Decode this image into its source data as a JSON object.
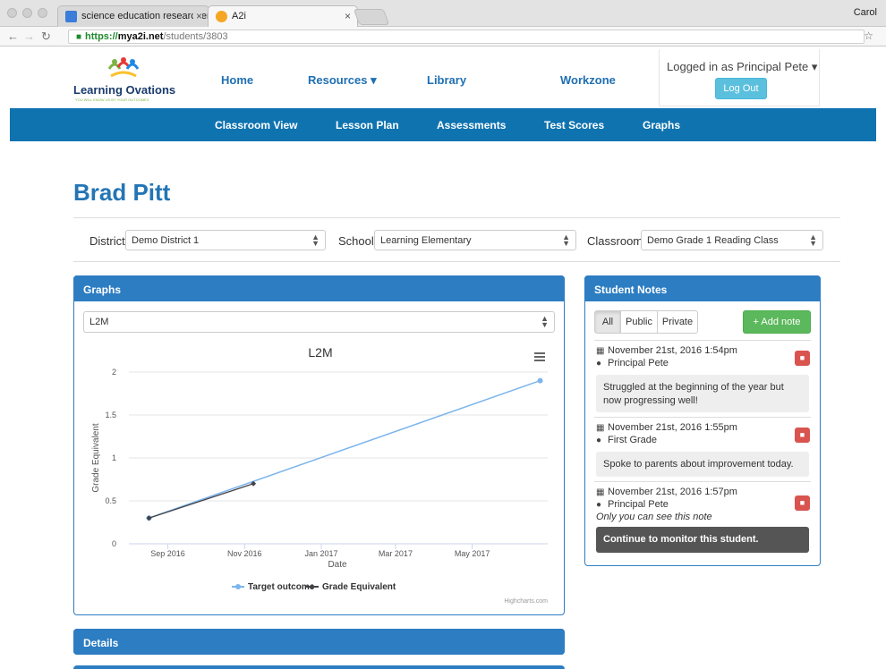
{
  "browser": {
    "tabs": [
      {
        "title": "science education researchers",
        "active": false
      },
      {
        "title": "A2i",
        "active": true
      }
    ],
    "profile": "Carol",
    "url": {
      "scheme": "https://",
      "host": "mya2i.net",
      "path": "/students/3803"
    }
  },
  "site": {
    "logo_name": "Learning Ovations",
    "logo_tagline": "YOU WILL KNOW US BY YOUR OUTCOMES",
    "nav": [
      "Home",
      "Resources ▾",
      "Library",
      "Workzone"
    ],
    "user_label": "Logged in as Principal Pete ▾",
    "logout_label": "Log Out",
    "subnav": [
      "Classroom View",
      "Lesson Plan",
      "Assessments",
      "Test Scores",
      "Graphs"
    ]
  },
  "student": {
    "name": "Brad Pitt"
  },
  "filters": {
    "district_label": "District",
    "district_value": "Demo District 1",
    "school_label": "School",
    "school_value": "Learning Elementary",
    "classroom_label": "Classroom",
    "classroom_value": "Demo Grade 1 Reading Class"
  },
  "graphs_panel": {
    "title": "Graphs",
    "select_value": "L2M"
  },
  "chart_data": {
    "type": "line",
    "title": "L2M",
    "xlabel": "Date",
    "ylabel": "Grade Equivalent",
    "ylim": [
      0,
      2
    ],
    "yticks": [
      "0",
      "0.5",
      "1",
      "1.5",
      "2"
    ],
    "xlim": [
      "2016-08-01",
      "2017-06-30"
    ],
    "xticks": [
      {
        "label": "Sep 2016",
        "date": "2016-09-01"
      },
      {
        "label": "Nov 2016",
        "date": "2016-11-01"
      },
      {
        "label": "Jan 2017",
        "date": "2017-01-01"
      },
      {
        "label": "Mar 2017",
        "date": "2017-03-01"
      },
      {
        "label": "May 2017",
        "date": "2017-05-01"
      }
    ],
    "series": [
      {
        "name": "Target outcome",
        "color": "#7cb5ec",
        "points": [
          {
            "x": "2016-08-17",
            "y": 0.3
          },
          {
            "x": "2017-06-24",
            "y": 1.9
          }
        ]
      },
      {
        "name": "Grade Equivalent",
        "color": "#434348",
        "points": [
          {
            "x": "2016-08-17",
            "y": 0.3
          },
          {
            "x": "2016-11-08",
            "y": 0.7
          }
        ]
      }
    ],
    "credit": "Highcharts.com",
    "legend": "bottom-center",
    "grid": true
  },
  "details_panel": {
    "title": "Details"
  },
  "notes_panel": {
    "title": "Student Notes",
    "filters": [
      "All",
      "Public",
      "Private"
    ],
    "active_filter": "All",
    "add_label": "+ Add note",
    "notes": [
      {
        "date": "November 21st, 2016 1:54pm",
        "author": "Principal Pete",
        "body": "Struggled at the beginning of the year but now progressing well!",
        "private_note": ""
      },
      {
        "date": "November 21st, 2016 1:55pm",
        "author": "First Grade",
        "body": "Spoke to parents about improvement today.",
        "private_note": ""
      },
      {
        "date": "November 21st, 2016 1:57pm",
        "author": "Principal Pete",
        "body": "Continue to monitor this student.",
        "private_note": "Only you can see this note"
      }
    ]
  }
}
